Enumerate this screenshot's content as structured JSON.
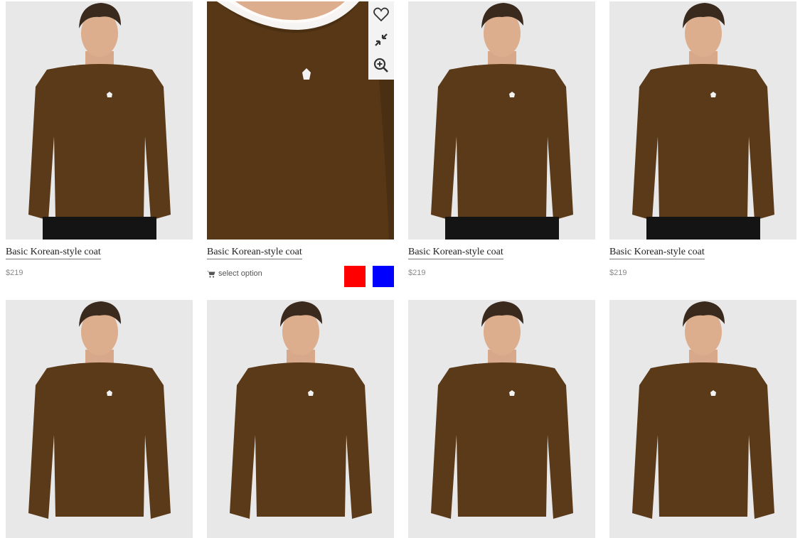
{
  "products": [
    {
      "title": "Basic Korean-style coat",
      "price": "$219",
      "image": "sweater-model-full"
    },
    {
      "title": "Basic Korean-style coat",
      "select_label": "select option",
      "image": "sweater-closeup",
      "swatches": [
        {
          "name": "red",
          "color": "#ff0000"
        },
        {
          "name": "blue",
          "color": "#0000ff"
        }
      ],
      "actions": [
        "heart-icon",
        "compress-icon",
        "zoom-in-icon"
      ]
    },
    {
      "title": "Basic Korean-style coat",
      "price": "$219",
      "image": "sweater-model-full"
    },
    {
      "title": "Basic Korean-style coat",
      "price": "$219",
      "image": "sweater-model-full"
    },
    {
      "image": "sweater-model-full"
    },
    {
      "image": "sweater-model-full"
    },
    {
      "image": "sweater-model-full"
    },
    {
      "image": "sweater-model-full"
    }
  ],
  "colors": {
    "sweater": "#5a3a18",
    "background": "#e9e8e9",
    "price": "#8a8a8a"
  }
}
